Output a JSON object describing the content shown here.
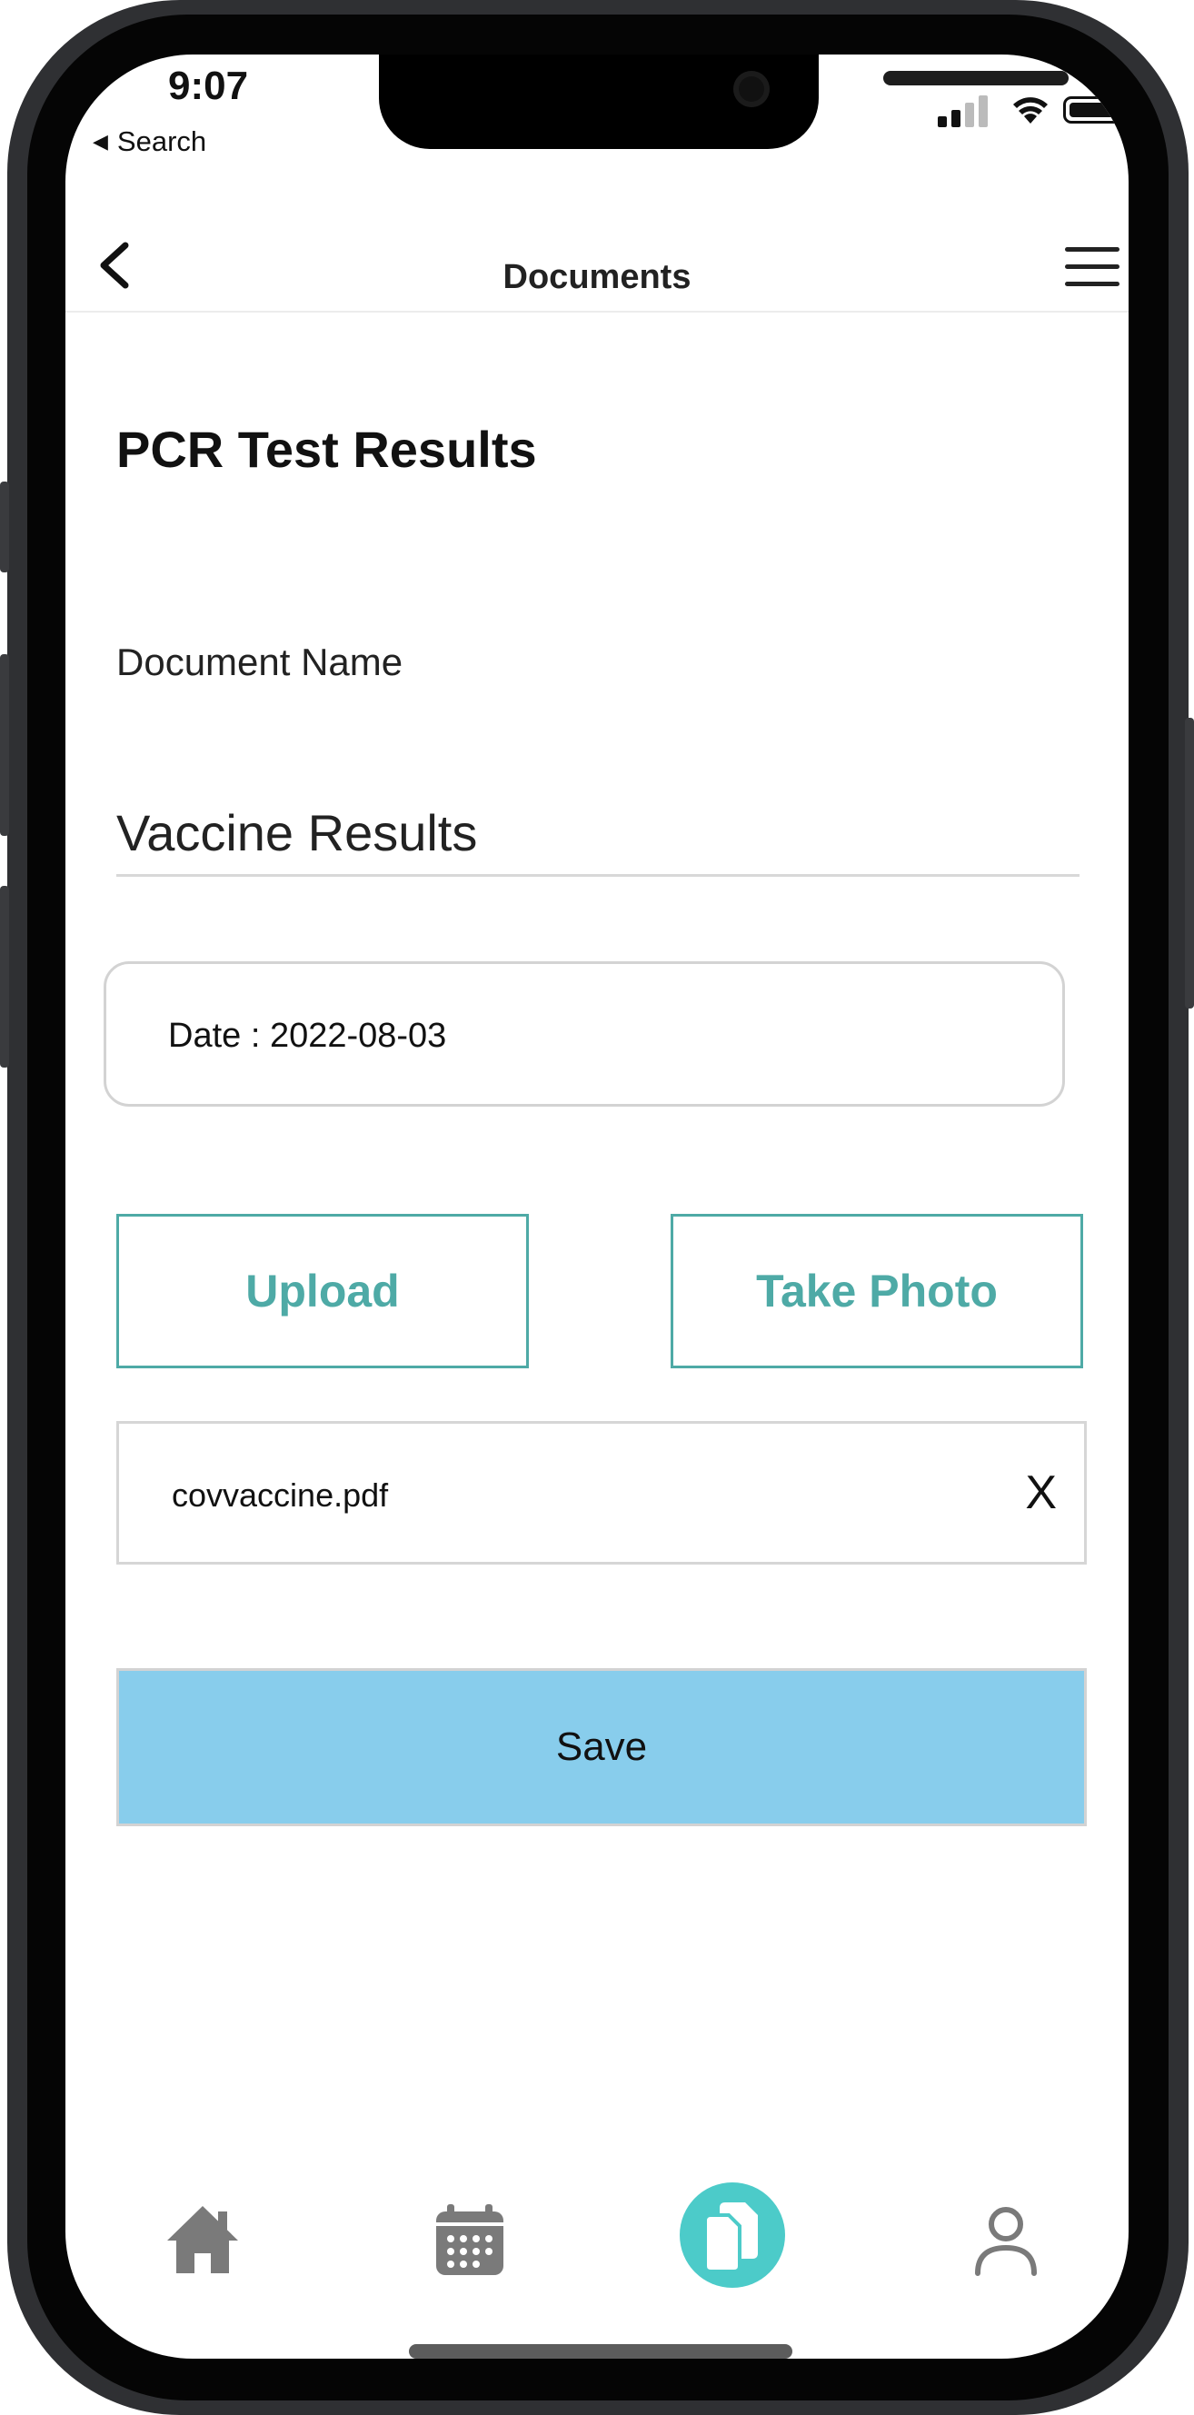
{
  "status_bar": {
    "time": "9:07",
    "back_app": "Search"
  },
  "header": {
    "title": "Documents"
  },
  "page": {
    "heading": "PCR Test Results",
    "document_name_label": "Document Name",
    "document_name_value": "Vaccine Results",
    "date": "Date : 2022-08-03"
  },
  "actions": {
    "upload_label": "Upload",
    "take_photo_label": "Take Photo"
  },
  "attachment": {
    "file_name": "covvaccine.pdf",
    "remove_label": "X"
  },
  "save_label": "Save",
  "bottom_nav": {
    "items": [
      {
        "icon": "home-icon",
        "active": false
      },
      {
        "icon": "calendar-icon",
        "active": false
      },
      {
        "icon": "documents-icon",
        "active": true
      },
      {
        "icon": "profile-icon",
        "active": false
      }
    ]
  },
  "colors": {
    "accent_teal": "#4eaaa6",
    "active_nav": "#4ccbc9",
    "save_button": "#88cdec",
    "nav_icon_gray": "#7a7a7a"
  }
}
